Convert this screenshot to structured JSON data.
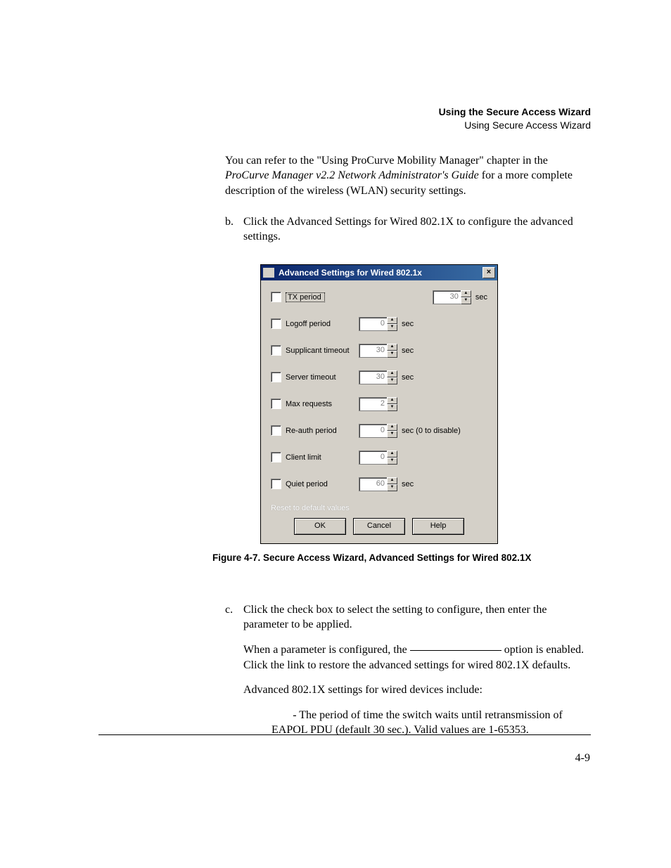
{
  "header": {
    "title": "Using the Secure Access Wizard",
    "subtitle": "Using Secure Access Wizard"
  },
  "intro": {
    "pre": "You can refer to the \"Using ProCurve Mobility Manager\" chapter in the ",
    "italic": "ProCurve Manager v2.2 Network Administrator's Guide",
    "post": " for a more complete description of the wireless (WLAN) security settings."
  },
  "step_b": {
    "marker": "b.",
    "text": "Click the Advanced Settings for Wired 802.1X to configure the advanced settings."
  },
  "dialog": {
    "title": "Advanced Settings for Wired 802.1x",
    "close": "×",
    "rows": [
      {
        "label": "TX period",
        "value": "30",
        "unit": "sec",
        "dotted": true
      },
      {
        "label": "Logoff period",
        "value": "0",
        "unit": "sec"
      },
      {
        "label": "Supplicant timeout",
        "value": "30",
        "unit": "sec"
      },
      {
        "label": "Server timeout",
        "value": "30",
        "unit": "sec"
      },
      {
        "label": "Max requests",
        "value": "2",
        "unit": ""
      },
      {
        "label": "Re-auth period",
        "value": "0",
        "unit": "sec (0 to disable)"
      },
      {
        "label": "Client limit",
        "value": "0",
        "unit": ""
      },
      {
        "label": "Quiet period",
        "value": "60",
        "unit": "sec"
      }
    ],
    "reset": "Reset to default values",
    "buttons": {
      "ok": "OK",
      "cancel": "Cancel",
      "help": "Help"
    }
  },
  "figcaption": "Figure 4-7. Secure Access Wizard, Advanced Settings for Wired 802.1X",
  "step_c": {
    "marker": "c.",
    "p1": "Click the check box to select the setting to configure, then enter the parameter to be applied.",
    "p2_pre": "When a parameter is configured, the ",
    "p2_post": " option is enabled. Click the link to restore the advanced settings for wired 802.1X defaults.",
    "p3": "Advanced 802.1X settings for wired devices include:",
    "bullet": " - The period of time the switch waits until retransmission of EAPOL PDU (default 30 sec.). Valid values are 1-65353."
  },
  "pagenum": "4-9"
}
